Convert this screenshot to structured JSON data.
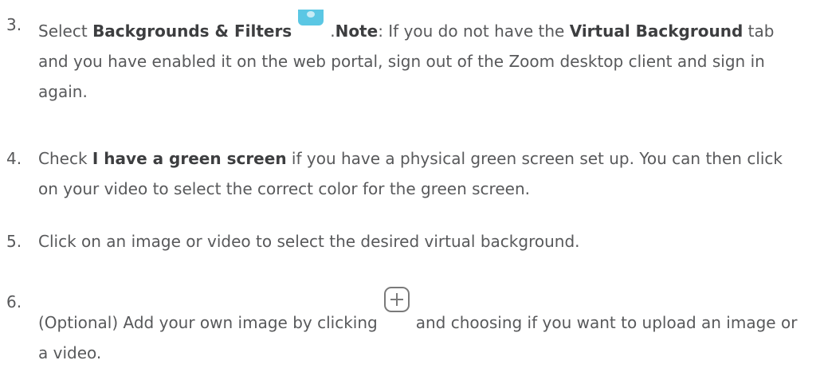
{
  "steps": [
    {
      "number": "3.",
      "parts": {
        "t1": "Select ",
        "b1": "Backgrounds & Filters",
        "icon": "backgrounds-filters-icon",
        "t2": ".",
        "b2": "Note",
        "t3": ": If you do not have the ",
        "b3": "Virtual Background",
        "t4": " tab and you have enabled it on the web portal, sign out of the Zoom desktop client and sign in again."
      }
    },
    {
      "number": "4.",
      "parts": {
        "t1": "Check ",
        "b1": "I have a green screen",
        "t2": " if you have a physical green screen set up. You can then click on your video to select the correct color for the green screen."
      }
    },
    {
      "number": "5.",
      "parts": {
        "t1": "Click on an image or video to select the desired virtual background."
      }
    },
    {
      "number": "6.",
      "parts": {
        "t1": "(Optional) Add your own image by clicking",
        "icon": "add-plus-icon",
        "t2": "and choosing if you want to upload an image or a video."
      }
    }
  ],
  "colors": {
    "text": "#58595b",
    "bold": "#3d3e40",
    "bg_icon": "#5bc7e4",
    "plus_icon": "#7a7a7a"
  }
}
